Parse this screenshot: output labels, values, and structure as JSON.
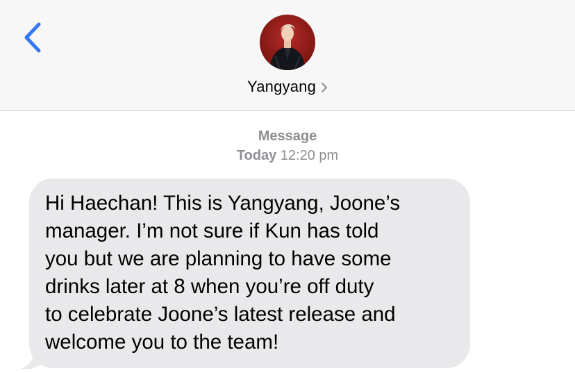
{
  "header": {
    "back_icon": "chevron-left-icon",
    "contact_name": "Yangyang",
    "contact_chevron_icon": "chevron-right-icon",
    "accent_color": "#3478f6"
  },
  "conversation": {
    "service_label": "Message",
    "timestamp_day": "Today",
    "timestamp_time": "12:20 pm",
    "messages": [
      {
        "direction": "incoming",
        "lines": [
          "Hi Haechan! This is Yangyang, Joone’s",
          "manager.  I’m not sure if Kun has told",
          "you but we are planning to have some",
          "drinks later at 8 when you’re off duty",
          "to celebrate Joone’s latest release and",
          "welcome you to the team!"
        ],
        "bubble_color": "#e9e9eb"
      }
    ]
  }
}
